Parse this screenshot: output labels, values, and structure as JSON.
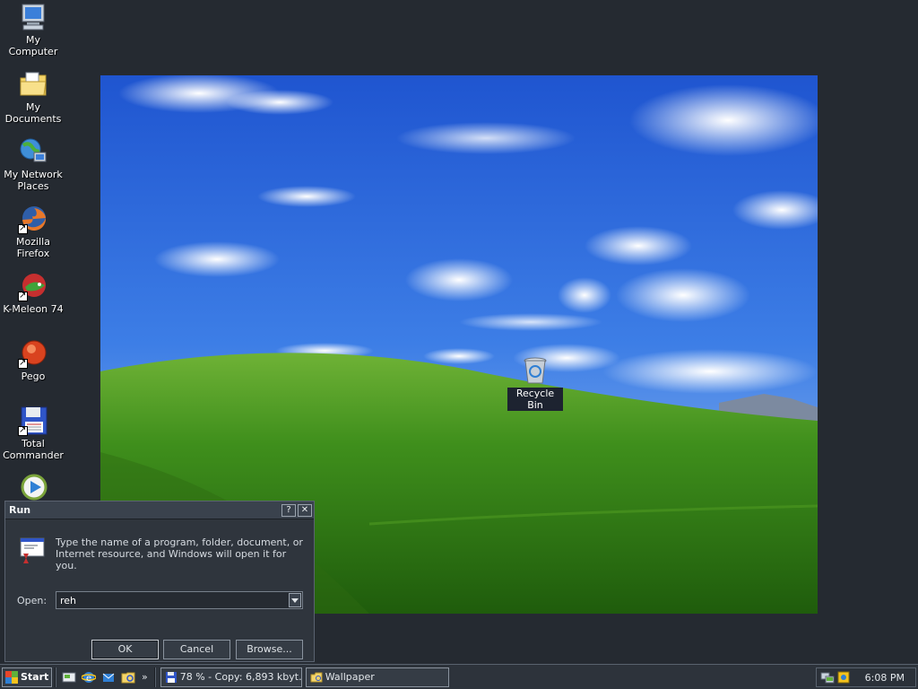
{
  "desktop": {
    "icons": [
      {
        "label": "My Computer",
        "icon": "computer-icon"
      },
      {
        "label": "My Documents",
        "icon": "folder-documents-icon"
      },
      {
        "label": "My Network Places",
        "icon": "network-places-icon"
      },
      {
        "label": "Mozilla Firefox",
        "icon": "firefox-icon"
      },
      {
        "label": "K-Meleon 74",
        "icon": "k-meleon-icon"
      },
      {
        "label": "Pego",
        "icon": "pego-icon"
      },
      {
        "label": "Total Commander",
        "icon": "floppy-disk-icon"
      },
      {
        "label": "",
        "icon": "media-player-icon"
      }
    ],
    "recycle_bin": {
      "label": "Recycle Bin",
      "icon": "recycle-bin-icon"
    }
  },
  "run_dialog": {
    "title": "Run",
    "help_button": "?",
    "close_button": "✕",
    "description": "Type the name of a program, folder, document, or Internet resource, and Windows will open it for you.",
    "open_label": "Open:",
    "open_value": "reh",
    "ok_label": "OK",
    "cancel_label": "Cancel",
    "browse_label": "Browse..."
  },
  "taskbar": {
    "start_label": "Start",
    "quick_launch": [
      "show-desktop-icon",
      "ie-icon",
      "outlook-icon",
      "explorer-icon"
    ],
    "chevron": "»",
    "tasks": [
      {
        "label": "78 % - Copy: 6,893 kbyt...",
        "icon": "floppy-disk-icon"
      },
      {
        "label": "Wallpaper",
        "icon": "folder-icon"
      }
    ],
    "tray_icons": [
      "network-icon",
      "tray-app-icon"
    ],
    "clock": "6:08 PM"
  },
  "colors": {
    "desktop_bg": "#252a31",
    "sky": "#2f63d6",
    "hill": "#3c8d1d"
  }
}
